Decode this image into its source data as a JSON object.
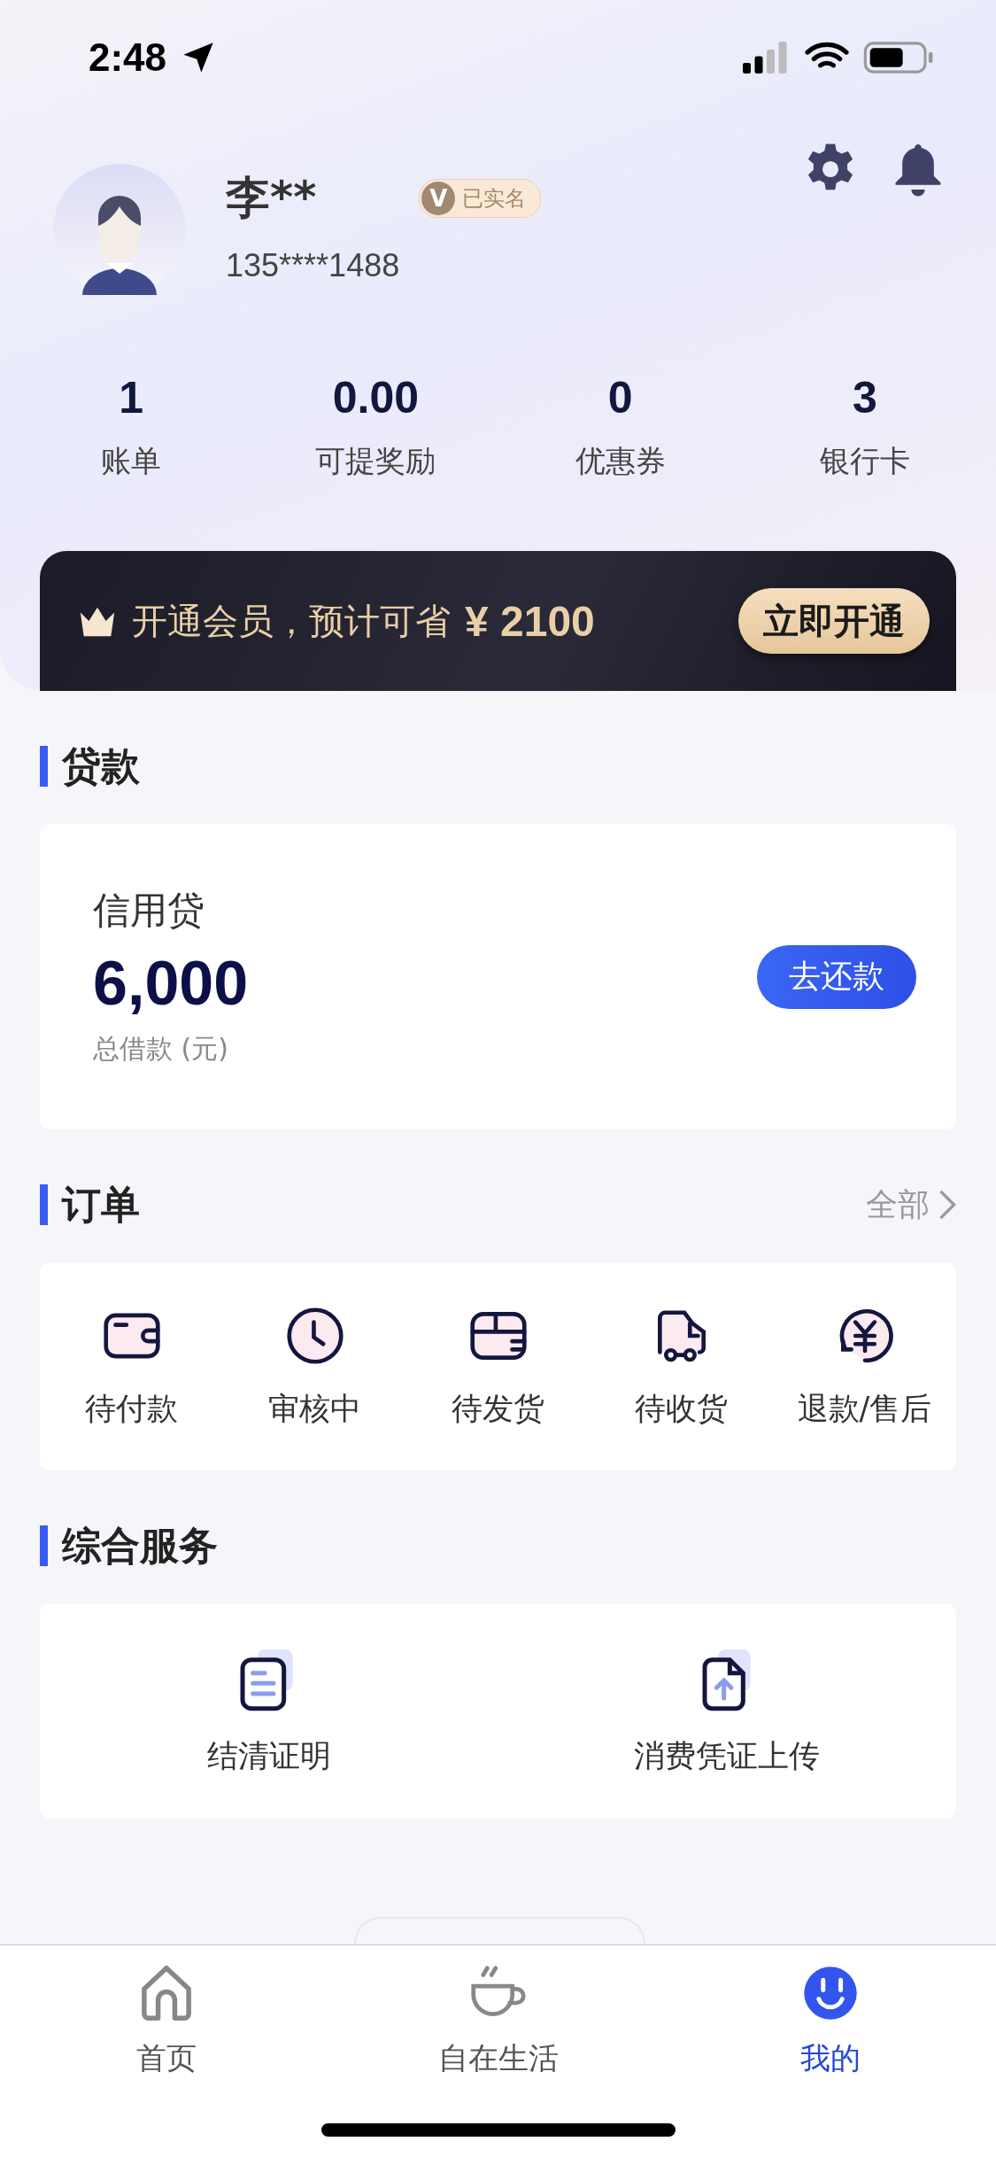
{
  "status_bar": {
    "time": "2:48"
  },
  "profile": {
    "name": "李**",
    "badge_mark": "V",
    "badge": "已实名",
    "phone": "135****1488"
  },
  "stats": [
    {
      "value": "1",
      "label": "账单"
    },
    {
      "value": "0.00",
      "label": "可提奖励"
    },
    {
      "value": "0",
      "label": "优惠券"
    },
    {
      "value": "3",
      "label": "银行卡"
    }
  ],
  "membership": {
    "text": "开通会员，预计可省",
    "amount": "¥ 2100",
    "button": "立即开通"
  },
  "loan_section": {
    "title": "贷款",
    "product": "信用贷",
    "amount": "6,000",
    "caption": "总借款 (元)",
    "button": "去还款"
  },
  "orders_section": {
    "title": "订单",
    "more": "全部",
    "items": [
      {
        "kind": "wallet",
        "label": "待付款"
      },
      {
        "kind": "clock",
        "label": "审核中"
      },
      {
        "kind": "box",
        "label": "待发货"
      },
      {
        "kind": "truck",
        "label": "待收货"
      },
      {
        "kind": "refund",
        "label": "退款/售后"
      }
    ]
  },
  "services_section": {
    "title": "综合服务",
    "items": [
      {
        "kind": "document",
        "label": "结清证明"
      },
      {
        "kind": "upload",
        "label": "消费凭证上传"
      }
    ]
  },
  "tab_bar": [
    {
      "kind": "home",
      "label": "首页",
      "selected": false
    },
    {
      "kind": "cup",
      "label": "自在生活",
      "selected": false
    },
    {
      "kind": "smile",
      "label": "我的",
      "selected": true
    }
  ]
}
